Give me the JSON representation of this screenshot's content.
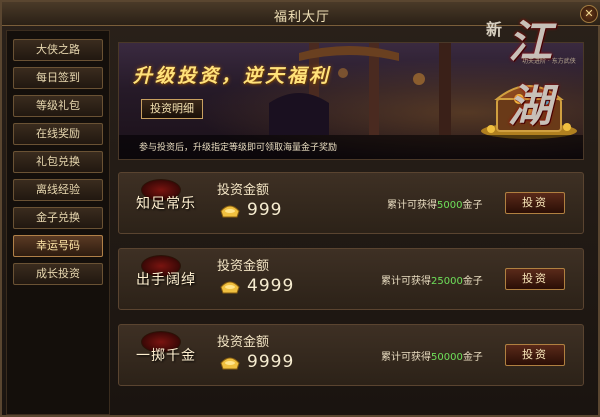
{
  "window": {
    "title": "福利大厅",
    "close_icon": "close-icon"
  },
  "sidebar": {
    "items": [
      {
        "label": "大侠之路",
        "active": false
      },
      {
        "label": "每日签到",
        "active": false
      },
      {
        "label": "等级礼包",
        "active": false
      },
      {
        "label": "在线奖励",
        "active": false
      },
      {
        "label": "礼包兑换",
        "active": false
      },
      {
        "label": "离线经验",
        "active": false
      },
      {
        "label": "金子兑换",
        "active": false
      },
      {
        "label": "幸运号码",
        "active": true
      },
      {
        "label": "成长投资",
        "active": false
      }
    ]
  },
  "logo": {
    "prefix": "新",
    "name": "江湖",
    "subtitle": "功夫进阶 · 东方武侠"
  },
  "banner": {
    "slogan": "升级投资，逆天福利",
    "detail_button": "投资明细",
    "note": "参与投资后，升级指定等级即可领取海量金子奖励"
  },
  "cards": [
    {
      "name": "知足常乐",
      "label": "投资金额",
      "amount": "999",
      "reward_prefix": "累计可获得",
      "reward_value": "5000",
      "reward_suffix": "金子",
      "button": "投资"
    },
    {
      "name": "出手阔绰",
      "label": "投资金额",
      "amount": "4999",
      "reward_prefix": "累计可获得",
      "reward_value": "25000",
      "reward_suffix": "金子",
      "button": "投资"
    },
    {
      "name": "一掷千金",
      "label": "投资金额",
      "amount": "9999",
      "reward_prefix": "累计可获得",
      "reward_value": "50000",
      "reward_suffix": "金子",
      "button": "投资"
    }
  ],
  "colors": {
    "accent": "#c8a060",
    "reward_number": "#6ee05a",
    "slogan": "#ffe27a"
  }
}
